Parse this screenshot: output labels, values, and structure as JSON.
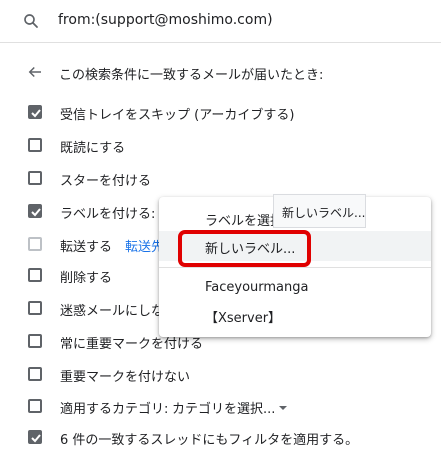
{
  "search": {
    "icon": "search-icon",
    "query": "from:(support@moshimo.com)"
  },
  "header": {
    "back_icon": "arrow-left-icon",
    "text": "この検索条件に一致するメールが届いたとき:"
  },
  "options": [
    {
      "label": "受信トレイをスキップ (アーカイブする)",
      "checked": true
    },
    {
      "label": "既読にする",
      "checked": false
    },
    {
      "label": "スターを付ける",
      "checked": false
    },
    {
      "label": "ラベルを付ける:",
      "checked": true
    },
    {
      "label": "転送する",
      "checked": false,
      "disabled": true,
      "link": "転送先"
    },
    {
      "label": "削除する",
      "checked": false
    },
    {
      "label": "迷惑メールにしない",
      "checked": false
    },
    {
      "label": "常に重要マークを付ける",
      "checked": false
    },
    {
      "label": "重要マークを付けない",
      "checked": false
    },
    {
      "label": "適用するカテゴリ:",
      "checked": false,
      "select_value": "カテゴリを選択..."
    },
    {
      "label": "6 件の一致するスレッドにもフィルタを適用する。",
      "checked": true
    }
  ],
  "label_menu": {
    "items": [
      {
        "label": "ラベルを選択..."
      },
      {
        "label": "新しいラベル..."
      },
      {
        "label": "Faceyourmanga"
      },
      {
        "label": "【Xserver】"
      }
    ],
    "tooltip": "新しいラベル..."
  },
  "colors": {
    "checkbox": "#5f6368",
    "link": "#1a73e8",
    "highlight": "#e00000"
  }
}
